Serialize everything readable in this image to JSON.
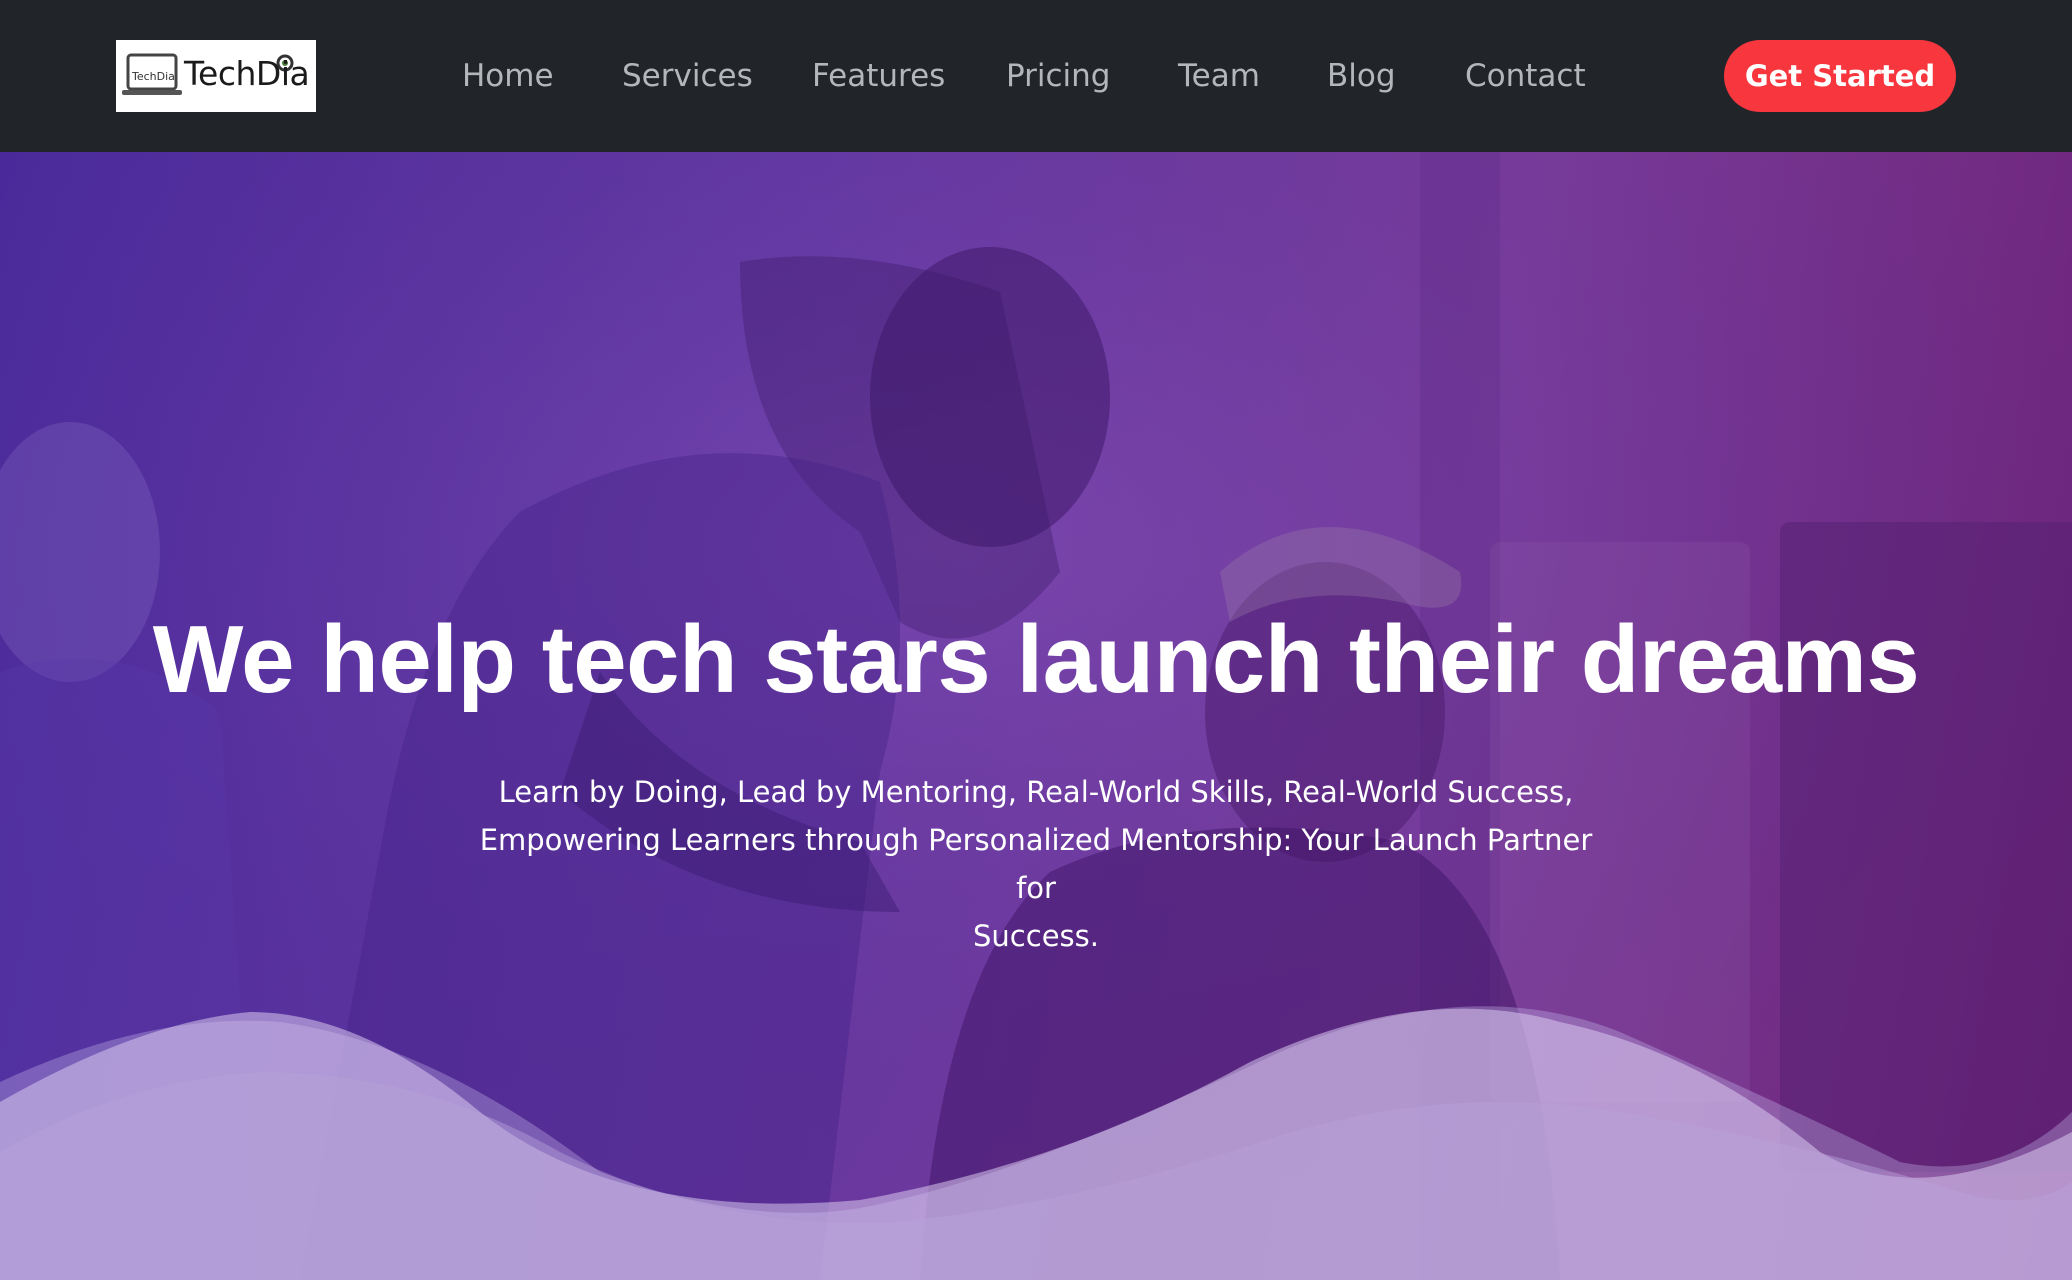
{
  "nav": {
    "logo_text": "TechDia",
    "logo_small_text": "TechDia",
    "links": [
      "Home",
      "Services",
      "Features",
      "Pricing",
      "Team",
      "Blog",
      "Contact"
    ],
    "cta_label": "Get Started"
  },
  "hero": {
    "title": "We help tech stars launch their dreams",
    "subtitle_line1": "Learn by Doing, Lead by Mentoring, Real-World Skills, Real-World Success,",
    "subtitle_line2": "Empowering Learners through Personalized Mentorship: Your Launch Partner for",
    "subtitle_line3": "Success."
  },
  "colors": {
    "navbar_bg": "#212529",
    "nav_link": "#b3b6ba",
    "cta_bg": "#f7363e",
    "hero_gradient_start": "#4a2a9a",
    "hero_gradient_end": "#6d2277"
  },
  "icons": [
    "laptop-logo-icon",
    "webcam-dot-icon"
  ]
}
